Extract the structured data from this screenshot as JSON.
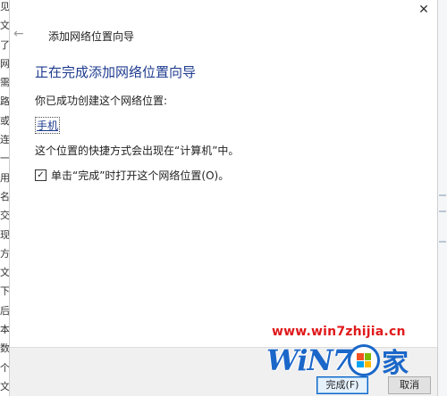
{
  "background_left_chars": [
    "见",
    "文",
    "了",
    "网",
    "需",
    "路",
    "或",
    "连",
    "一",
    "用",
    "名",
    "交",
    "现",
    "方",
    "文",
    "下",
    "后",
    "本",
    "数",
    "个",
    "文",
    "设"
  ],
  "dialog": {
    "wizard_title": "添加网络位置向导",
    "heading": "正在完成添加网络位置向导",
    "created_text": "你已成功创建这个网络位置:",
    "location_name": "手机",
    "shortcut_text": "这个位置的快捷方式会出现在“计算机”中。",
    "open_checkbox_label": "单击“完成”时打开这个网络位置(O)。",
    "open_checkbox_checked": true
  },
  "footer": {
    "finish_label": "完成(F)",
    "cancel_label": "取消"
  },
  "icons": {
    "close": "close-icon",
    "back": "back-arrow-icon",
    "check": "checkmark-icon"
  },
  "watermark": {
    "url": "www.win7zhijia.cn",
    "brand": "WiN7",
    "suffix": "家"
  },
  "colors": {
    "heading": "#1f3c8f",
    "watermark_url": "#e0191b",
    "watermark_logo": "#1b67c9",
    "primary_button_border": "#0a64c8"
  }
}
